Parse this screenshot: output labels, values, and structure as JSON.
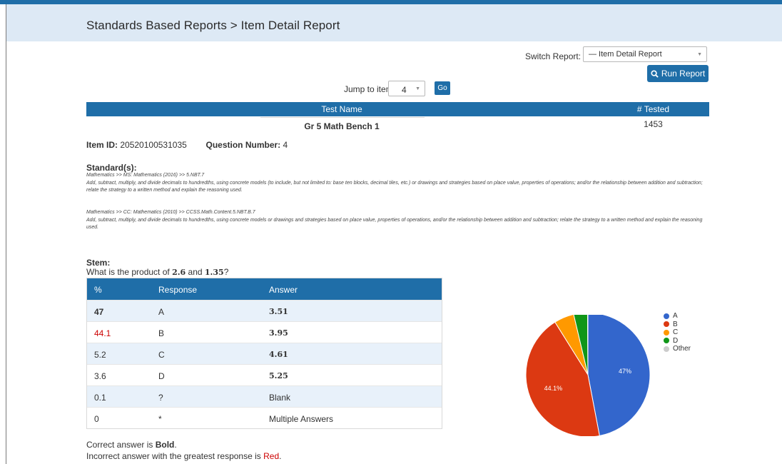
{
  "header": {
    "title": "Standards Based Reports > Item Detail Report"
  },
  "controls": {
    "switch_label": "Switch Report:",
    "switch_value": "— Item Detail Report",
    "run_label": "Run Report",
    "jump_label": "Jump to item:",
    "jump_value": "4",
    "go_label": "Go"
  },
  "test_table": {
    "col_name": "Test Name",
    "col_tested": "# Tested",
    "name": "Gr 5 Math Bench 1",
    "tested": "1453"
  },
  "item": {
    "id_label": "Item ID:",
    "id_value": "20520100531035",
    "qnum_label": "Question Number:",
    "qnum_value": "4"
  },
  "standards": {
    "heading": "Standard(s):",
    "entries": [
      {
        "path": "Mathematics >> MS: Mathematics (2016) >> 5.NBT.7",
        "text": "Add, subtract, multiply, and divide decimals to hundredths, using concrete models (to include, but not limited to: base ten blocks, decimal tiles, etc.) or drawings and strategies based on place value, properties of operations; and/or the relationship between addition and subtraction; relate the strategy to a written method and explain the reasoning used."
      },
      {
        "path": "Mathematics >> CC: Mathematics (2010) >> CCSS.Math.Content.5.NBT.B.7",
        "text": "Add, subtract, multiply, and divide decimals to hundredths, using concrete models or drawings and strategies based on place value, properties of operations, and/or the relationship between addition and subtraction; relate the strategy to a written method and explain the reasoning used."
      }
    ]
  },
  "stem": {
    "heading": "Stem:",
    "prefix": "What is the product of ",
    "n1": "2.6",
    "mid": " and ",
    "n2": "1.35",
    "suffix": "?"
  },
  "responses": {
    "headers": [
      "%",
      "Response",
      "Answer"
    ],
    "rows": [
      {
        "pct": "47",
        "resp": "A",
        "ans": "3.51"
      },
      {
        "pct": "44.1",
        "resp": "B",
        "ans": "3.95"
      },
      {
        "pct": "5.2",
        "resp": "C",
        "ans": "4.61"
      },
      {
        "pct": "3.6",
        "resp": "D",
        "ans": "5.25"
      },
      {
        "pct": "0.1",
        "resp": "?",
        "ans": "Blank"
      },
      {
        "pct": "0",
        "resp": "*",
        "ans": "Multiple Answers"
      }
    ]
  },
  "notes": {
    "line1_prefix": "Correct answer is ",
    "line1_bold": "Bold",
    "line1_suffix": ".",
    "line2_prefix": "Incorrect answer with the greatest response is ",
    "line2_red": "Red",
    "line2_suffix": "."
  },
  "chart_data": {
    "type": "pie",
    "title": "",
    "slices": [
      {
        "label": "A",
        "value": 47,
        "color": "#3366cc",
        "text": "47%"
      },
      {
        "label": "B",
        "value": 44.1,
        "color": "#dc3912",
        "text": "44.1%"
      },
      {
        "label": "C",
        "value": 5.2,
        "color": "#ff9900",
        "text": ""
      },
      {
        "label": "D",
        "value": 3.6,
        "color": "#109618",
        "text": ""
      },
      {
        "label": "Other",
        "value": 0.1,
        "color": "#cccccc",
        "text": ""
      }
    ],
    "legend_position": "right"
  }
}
